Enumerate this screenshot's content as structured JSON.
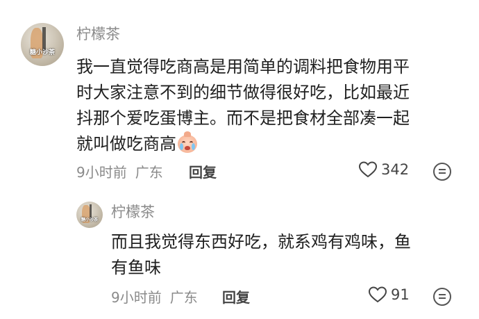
{
  "comment": {
    "avatar_tag": "糖小沙茶",
    "username": "柠檬茶",
    "text_lines": [
      "我一直觉得吃商高是用简单的调料把食物用平",
      "时大家注意不到的细节做得很好吃，比如最近",
      "抖那个爱吃蛋博主。而不是把食材全部凑一起",
      "就叫做吃商高"
    ],
    "emoji": "crying-face-emoji",
    "time": "9小时前",
    "location": "广东",
    "reply_label": "回复",
    "like_count": "342"
  },
  "reply": {
    "avatar_tag": "糖小沙茶",
    "username": "柠檬茶",
    "text_lines": [
      "而且我觉得东西好吃，就系鸡有鸡味，鱼",
      "有鱼味"
    ],
    "time": "9小时前",
    "location": "广东",
    "reply_label": "回复",
    "like_count": "91"
  },
  "icons": {
    "like": "heart-outline-icon",
    "more": "more-options-icon"
  }
}
